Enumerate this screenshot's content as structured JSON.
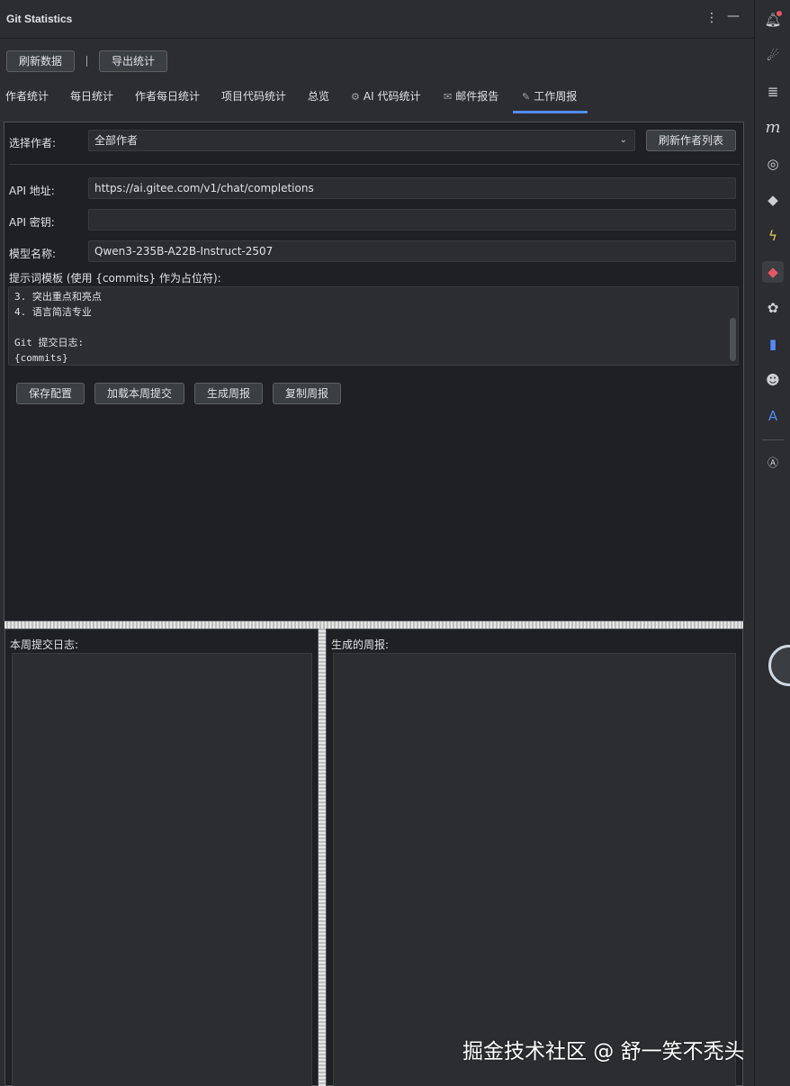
{
  "window": {
    "title": "Git Statistics"
  },
  "toolbar": {
    "refresh_label": "刷新数据",
    "export_label": "导出统计"
  },
  "tabs": [
    {
      "label": "作者统计"
    },
    {
      "label": "每日统计"
    },
    {
      "label": "作者每日统计"
    },
    {
      "label": "项目代码统计"
    },
    {
      "label": "总览"
    },
    {
      "label": "AI 代码统计",
      "icon": "robot-icon"
    },
    {
      "label": "邮件报告",
      "icon": "mail-icon"
    },
    {
      "label": "工作周报",
      "icon": "edit-icon",
      "active": true
    }
  ],
  "form": {
    "author_label": "选择作者:",
    "author_value": "全部作者",
    "refresh_authors_label": "刷新作者列表",
    "api_url_label": "API 地址:",
    "api_url_value": "https://ai.gitee.com/v1/chat/completions",
    "api_key_label": "API 密钥:",
    "api_key_value": "",
    "model_label": "模型名称:",
    "model_value": "Qwen3-235B-A22B-Instruct-2507",
    "prompt_label": "提示词模板 (使用 {commits} 作为占位符):",
    "prompt_lines": [
      "3. 突出重点和亮点",
      "4. 语言简洁专业",
      "",
      "Git 提交日志:",
      "{commits}"
    ]
  },
  "actions": {
    "save_label": "保存配置",
    "load_label": "加载本周提交",
    "generate_label": "生成周报",
    "copy_label": "复制周报"
  },
  "bottom": {
    "commits_label": "本周提交日志:",
    "report_label": "生成的周报:"
  },
  "watermark": "掘金技术社区 @ 舒一笑不秃头",
  "colors": {
    "accent": "#548af7",
    "background": "#2b2d30",
    "field": "#2b2d30"
  }
}
